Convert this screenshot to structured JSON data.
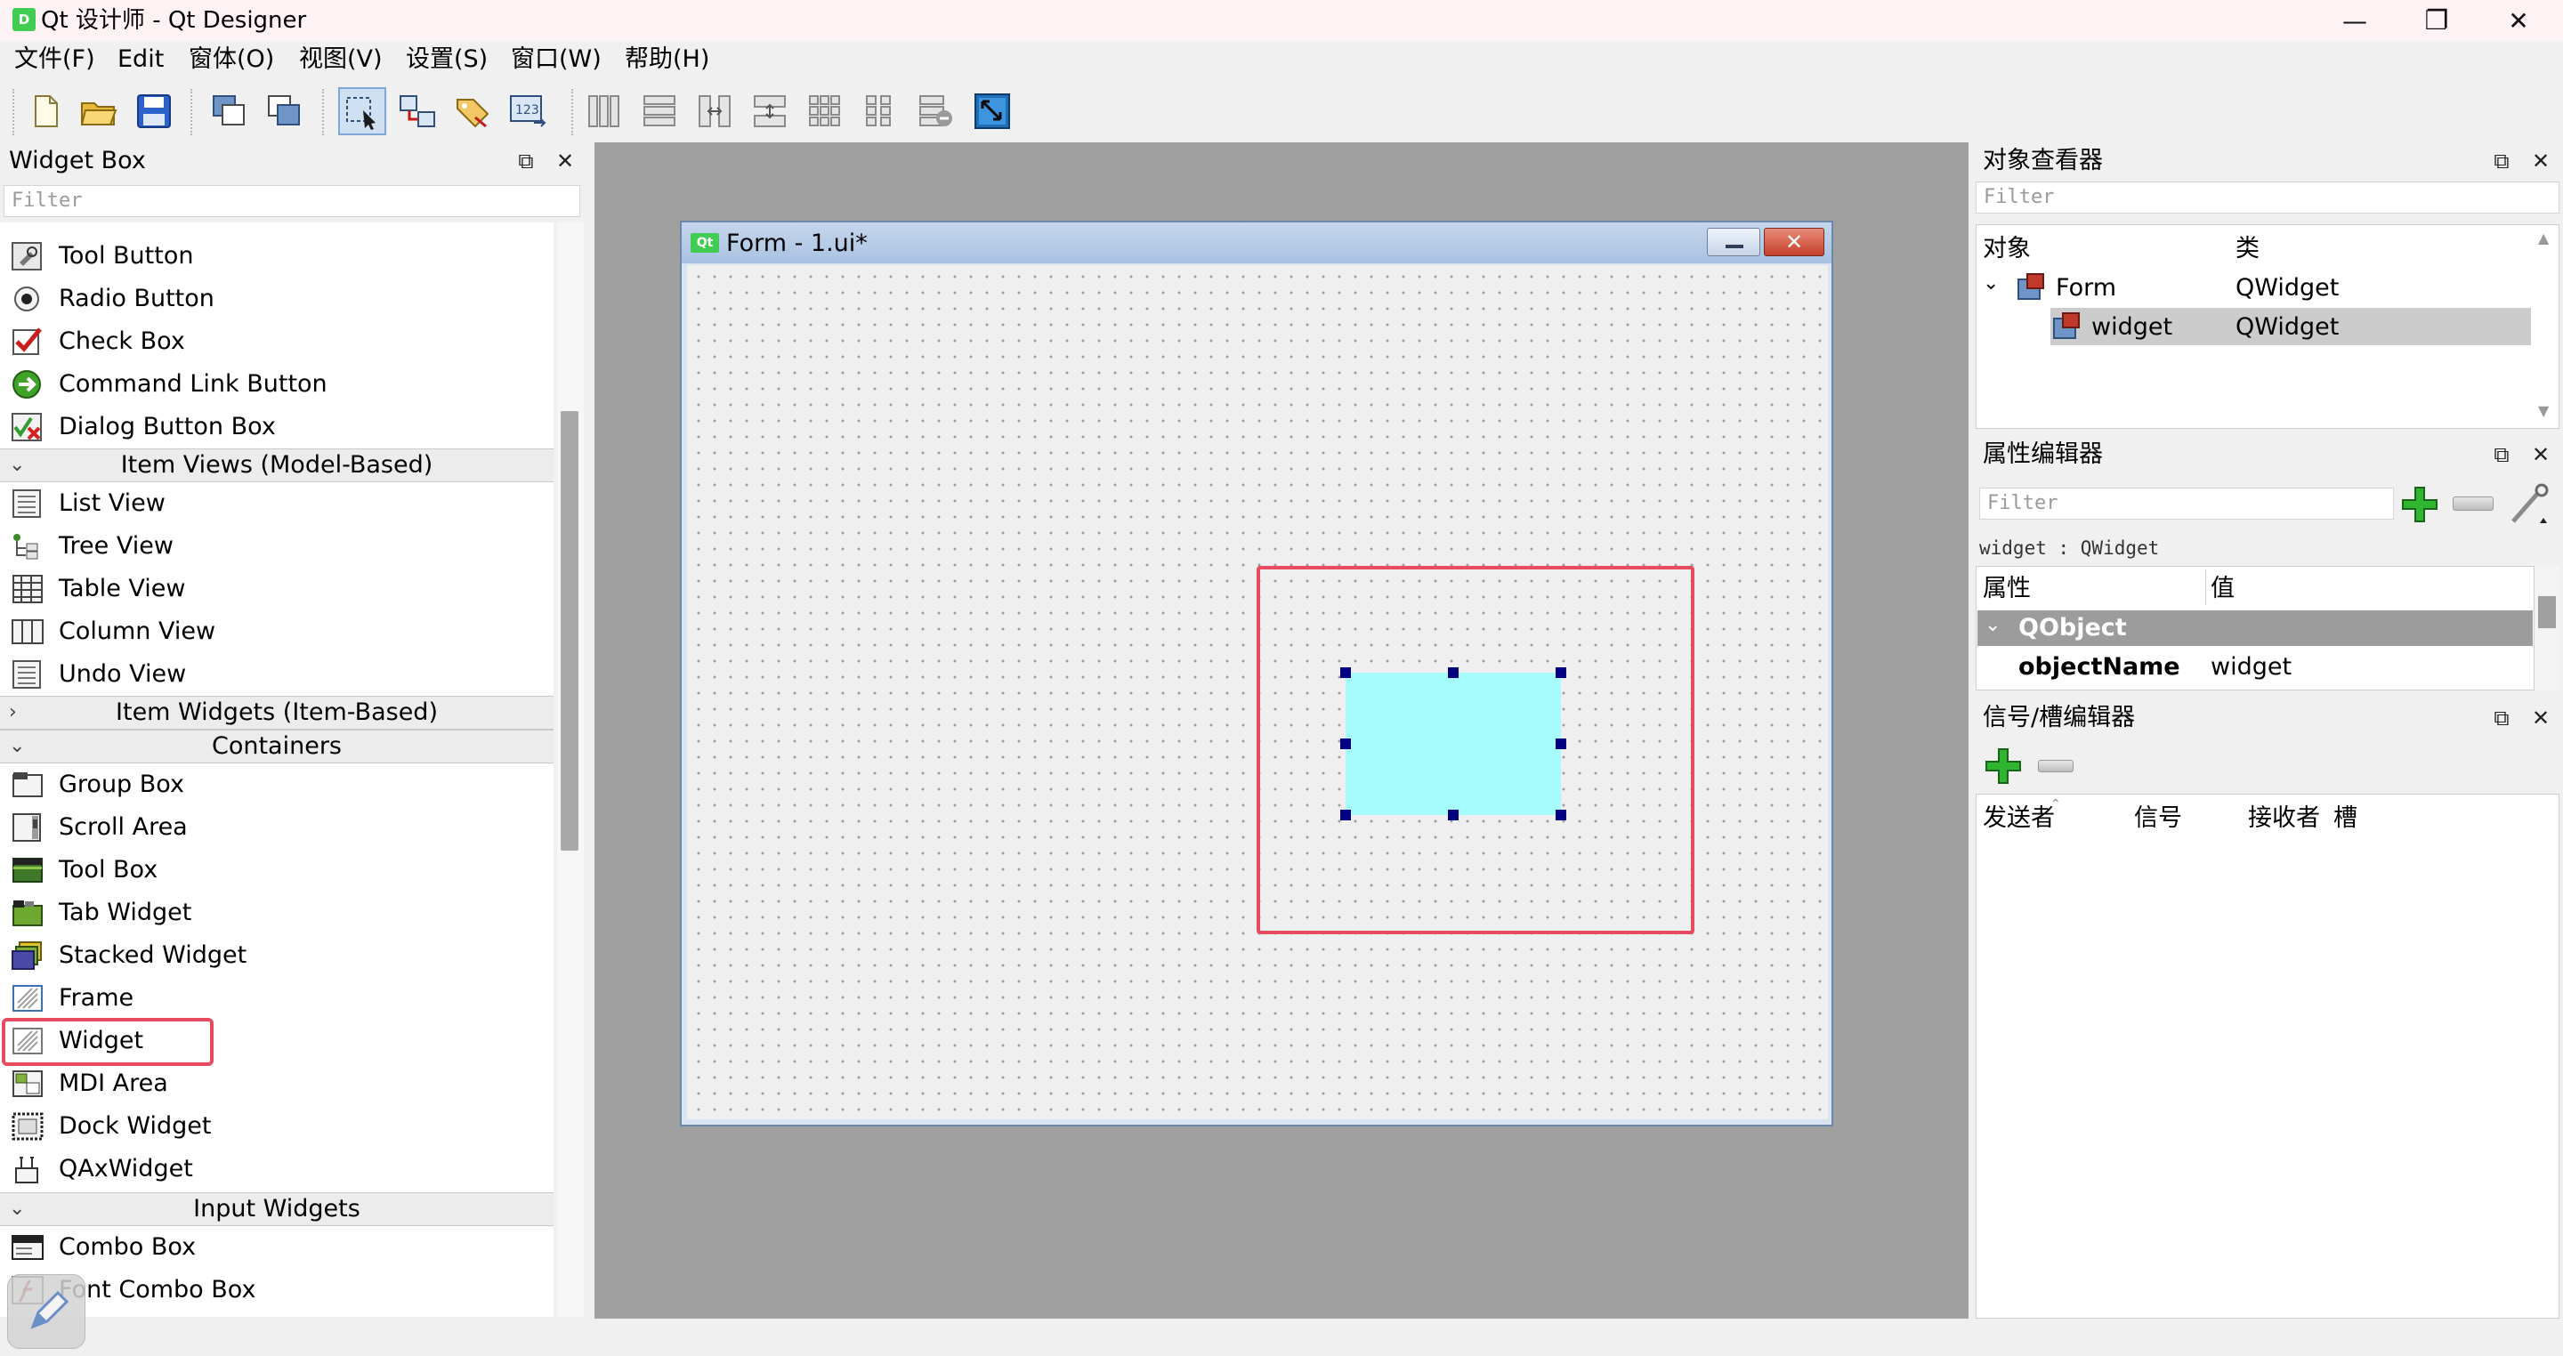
{
  "window": {
    "title": "Qt 设计师 - Qt Designer",
    "app_icon_text": "D",
    "controls": {
      "minimize": "—",
      "restore": "❐",
      "close": "✕"
    }
  },
  "menu": {
    "items": [
      "文件(F)",
      "Edit",
      "窗体(O)",
      "视图(V)",
      "设置(S)",
      "窗口(W)",
      "帮助(H)"
    ]
  },
  "toolbar": {
    "buttons": [
      "new-form",
      "open-form",
      "save-form",
      "send-to-back",
      "bring-to-front",
      "edit-widgets",
      "edit-signals-slots",
      "edit-buddies",
      "edit-tab-order",
      "layout-horizontal",
      "layout-vertical",
      "layout-horizontal-splitter",
      "layout-vertical-splitter",
      "layout-grid",
      "layout-form",
      "break-layout",
      "adjust-size"
    ],
    "checked": "edit-widgets"
  },
  "widget_box": {
    "title": "Widget Box",
    "filter_placeholder": "Filter",
    "items": [
      {
        "label": "Tool Button",
        "icon": "tool-button-icon"
      },
      {
        "label": "Radio Button",
        "icon": "radio-button-icon"
      },
      {
        "label": "Check Box",
        "icon": "check-box-icon"
      },
      {
        "label": "Command Link Button",
        "icon": "command-link-icon"
      },
      {
        "label": "Dialog Button Box",
        "icon": "dialog-button-box-icon"
      }
    ],
    "categories": {
      "item_views": "Item Views (Model-Based)",
      "item_widgets": "Item Widgets (Item-Based)",
      "containers": "Containers",
      "input_widgets": "Input Widgets"
    },
    "item_views": [
      "List View",
      "Tree View",
      "Table View",
      "Column View",
      "Undo View"
    ],
    "containers": [
      "Group Box",
      "Scroll Area",
      "Tool Box",
      "Tab Widget",
      "Stacked Widget",
      "Frame",
      "Widget",
      "MDI Area",
      "Dock Widget",
      "QAxWidget"
    ],
    "input_widgets": [
      "Combo Box",
      "Font Combo Box"
    ],
    "highlighted": "Widget"
  },
  "form": {
    "title": "Form - 1.ui*",
    "icon_text": "Qt",
    "close_glyph": "✕"
  },
  "object_inspector": {
    "title": "对象查看器",
    "filter_placeholder": "Filter",
    "col_object": "对象",
    "col_class": "类",
    "rows": [
      {
        "name": "Form",
        "class": "QWidget"
      },
      {
        "name": "widget",
        "class": "QWidget"
      }
    ]
  },
  "property_editor": {
    "title": "属性编辑器",
    "filter_placeholder": "Filter",
    "context": "widget : QWidget",
    "col_property": "属性",
    "col_value": "值",
    "group": "QObject",
    "row": {
      "property": "objectName",
      "value": "widget"
    }
  },
  "signal_slot_editor": {
    "title": "信号/槽编辑器",
    "cols": [
      "发送者",
      "信号",
      "接收者",
      "槽"
    ]
  },
  "colors": {
    "selection_cyan": "#a6fbfd",
    "highlight_red": "#e84a5f",
    "qt_green": "#41cd52",
    "qobject_group": "#9c9c9c"
  }
}
